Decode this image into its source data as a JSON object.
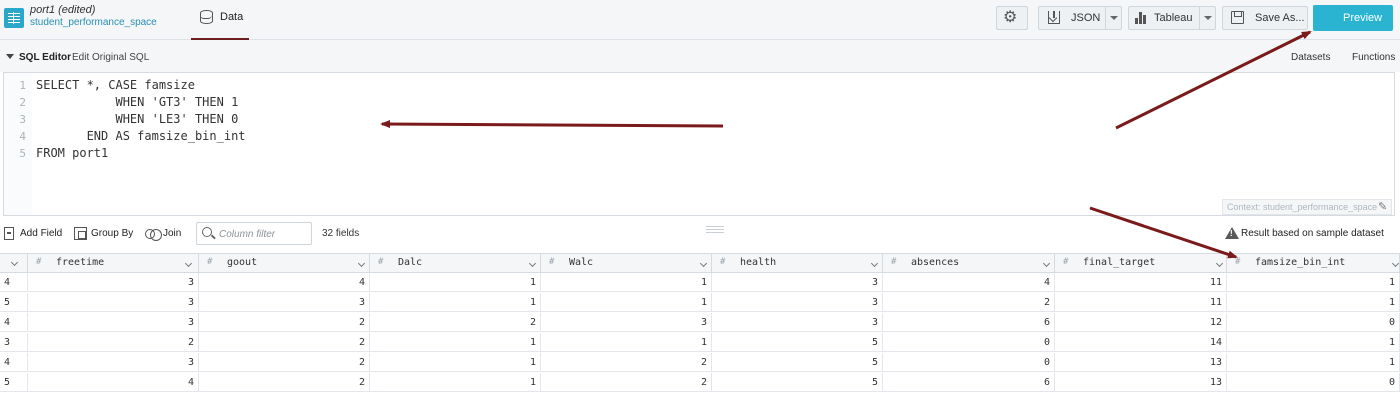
{
  "header": {
    "project_title": "port1 (edited)",
    "project_space": "student_performance_space",
    "data_tab": "Data",
    "json_label": "JSON",
    "tableau_label": "Tableau",
    "save_label": "Save As...",
    "preview_label": "Preview"
  },
  "sql_panel": {
    "title": "SQL Editor",
    "edit_link": "Edit Original SQL",
    "datasets_link": "Datasets",
    "functions_link": "Functions",
    "line_numbers": [
      "1",
      "2",
      "3",
      "4",
      "5"
    ],
    "code_lines": [
      "SELECT *, CASE famsize",
      "           WHEN 'GT3' THEN 1",
      "           WHEN 'LE3' THEN 0",
      "       END AS famsize_bin_int",
      "FROM port1"
    ],
    "context": "Context: student_performance_space"
  },
  "toolbar": {
    "add_field": "Add Field",
    "group_by": "Group By",
    "join": "Join",
    "column_filter_placeholder": "Column filter",
    "fields_count": "32 fields",
    "sample_notice": "Result based on sample dataset"
  },
  "table": {
    "columns": [
      "freetime",
      "goout",
      "Dalc",
      "Walc",
      "health",
      "absences",
      "final_target",
      "famsize_bin_int"
    ],
    "rows": [
      {
        "idx": "4",
        "cells": [
          "3",
          "4",
          "1",
          "1",
          "3",
          "4",
          "11",
          "1"
        ]
      },
      {
        "idx": "5",
        "cells": [
          "3",
          "3",
          "1",
          "1",
          "3",
          "2",
          "11",
          "1"
        ]
      },
      {
        "idx": "4",
        "cells": [
          "3",
          "2",
          "2",
          "3",
          "3",
          "6",
          "12",
          "0"
        ]
      },
      {
        "idx": "3",
        "cells": [
          "2",
          "2",
          "1",
          "1",
          "5",
          "0",
          "14",
          "1"
        ]
      },
      {
        "idx": "4",
        "cells": [
          "3",
          "2",
          "1",
          "2",
          "5",
          "0",
          "13",
          "1"
        ]
      },
      {
        "idx": "5",
        "cells": [
          "4",
          "2",
          "1",
          "2",
          "5",
          "6",
          "13",
          "0"
        ]
      }
    ]
  },
  "colors": {
    "accent": "#2bb4d2",
    "annotation_arrow": "#7b1a1a",
    "tab_underline": "#6d1f1f"
  }
}
